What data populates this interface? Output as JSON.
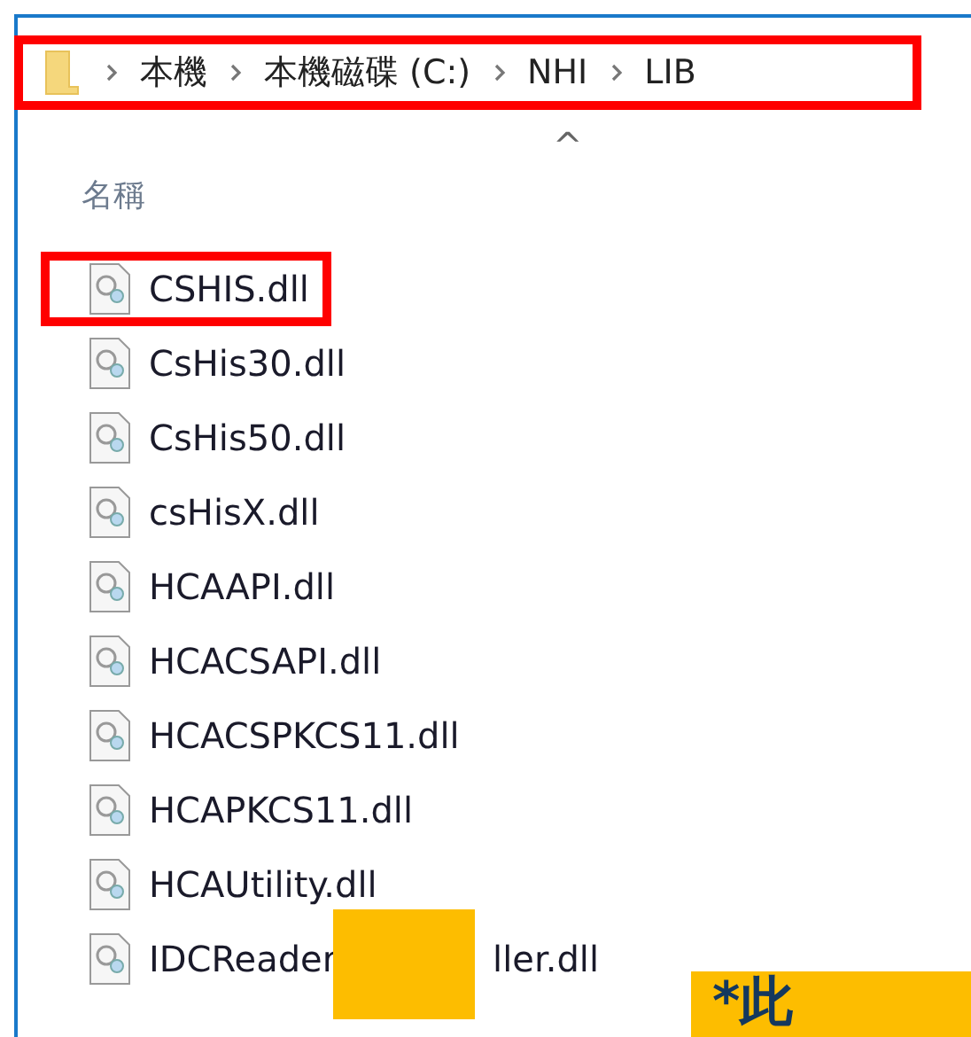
{
  "address_bar": {
    "highlighted": true,
    "path": [
      "本機",
      "本機磁碟 (C:)",
      "NHI",
      "LIB"
    ]
  },
  "file_list": {
    "sort_indicator": "^",
    "column_header": "名稱",
    "files": [
      {
        "name": "CSHIS.dll",
        "highlighted": true,
        "redacted": false
      },
      {
        "name": "CsHis30.dll",
        "highlighted": false,
        "redacted": false
      },
      {
        "name": "CsHis50.dll",
        "highlighted": false,
        "redacted": false
      },
      {
        "name": "csHisX.dll",
        "highlighted": false,
        "redacted": false
      },
      {
        "name": "HCAAPI.dll",
        "highlighted": false,
        "redacted": false
      },
      {
        "name": "HCACSAPI.dll",
        "highlighted": false,
        "redacted": false
      },
      {
        "name": "HCACSPKCS11.dll",
        "highlighted": false,
        "redacted": false
      },
      {
        "name": "HCAPKCS11.dll",
        "highlighted": false,
        "redacted": false
      },
      {
        "name": "HCAUtility.dll",
        "highlighted": false,
        "redacted": false
      },
      {
        "name": "IDCReader",
        "name_after": "ller.dll",
        "highlighted": false,
        "redacted": true
      }
    ]
  },
  "banner": {
    "text": "*此"
  }
}
